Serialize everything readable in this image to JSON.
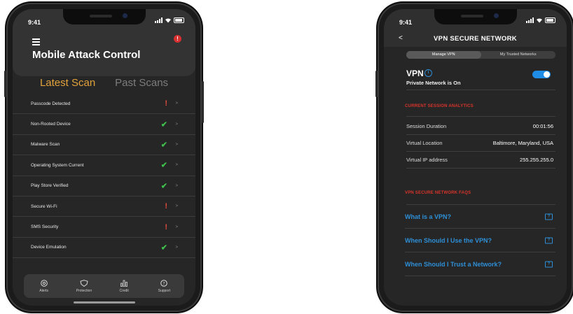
{
  "colors": {
    "accent_orange": "#e3a33c",
    "warning_red": "#e24b3c",
    "ok_green": "#3fbf4c",
    "link_blue": "#2e8fd6",
    "section_red": "#d9342b",
    "toggle_blue": "#1f8ce6"
  },
  "left_phone": {
    "status_bar": {
      "time": "9:41"
    },
    "header": {
      "title": "Mobile Attack Control",
      "alert_badge": "!"
    },
    "tabs": [
      {
        "label": "Latest Scan",
        "active": true
      },
      {
        "label": "Past Scans",
        "active": false
      }
    ],
    "scan_items": [
      {
        "label": "Passcode Detected",
        "status": "warning",
        "status_glyph": "!",
        "chevron": ">"
      },
      {
        "label": "Non-Rooted Device",
        "status": "ok",
        "status_glyph": "✔",
        "chevron": ">"
      },
      {
        "label": "Malware Scan",
        "status": "ok",
        "status_glyph": "✔",
        "chevron": ">"
      },
      {
        "label": "Operating System Current",
        "status": "ok",
        "status_glyph": "✔",
        "chevron": ">"
      },
      {
        "label": "Play Store Verified",
        "status": "ok",
        "status_glyph": "✔",
        "chevron": ">"
      },
      {
        "label": "Secure Wi-Fi",
        "status": "warning",
        "status_glyph": "!",
        "chevron": ">"
      },
      {
        "label": "SMS Security",
        "status": "warning",
        "status_glyph": "!",
        "chevron": ">"
      },
      {
        "label": "Device Emulation",
        "status": "ok",
        "status_glyph": "✔",
        "chevron": ">"
      }
    ],
    "tabbar": [
      {
        "label": "Alerts",
        "icon": "eye-icon"
      },
      {
        "label": "Protection",
        "icon": "shield-icon"
      },
      {
        "label": "Credit",
        "icon": "bar-chart-icon"
      },
      {
        "label": "Support",
        "icon": "question-circle-icon"
      }
    ]
  },
  "right_phone": {
    "status_bar": {
      "time": "9:41"
    },
    "header": {
      "back_glyph": "<",
      "title": "VPN SECURE NETWORK"
    },
    "segments": [
      {
        "label": "Manage VPN",
        "active": true
      },
      {
        "label": "My Trusted Networks",
        "active": false
      }
    ],
    "vpn": {
      "label": "VPN",
      "info_glyph": "i",
      "status": "Private Network is On",
      "enabled": true
    },
    "analytics": {
      "heading": "CURRENT SESSION ANALYTICS",
      "rows": [
        {
          "key": "Session Duration",
          "value": "00:01:56"
        },
        {
          "key": "Virtual Location",
          "value": "Baltimore, Maryland, USA"
        },
        {
          "key": "Virtual IP address",
          "value": "255.255.255.0"
        }
      ]
    },
    "faqs": {
      "heading": "VPN SECURE NETWORK FAQS",
      "icon_glyph": "?",
      "items": [
        {
          "label": "What is a VPN?"
        },
        {
          "label": "When Should I Use the VPN?"
        },
        {
          "label": "When Should I Trust a Network?"
        }
      ]
    }
  }
}
